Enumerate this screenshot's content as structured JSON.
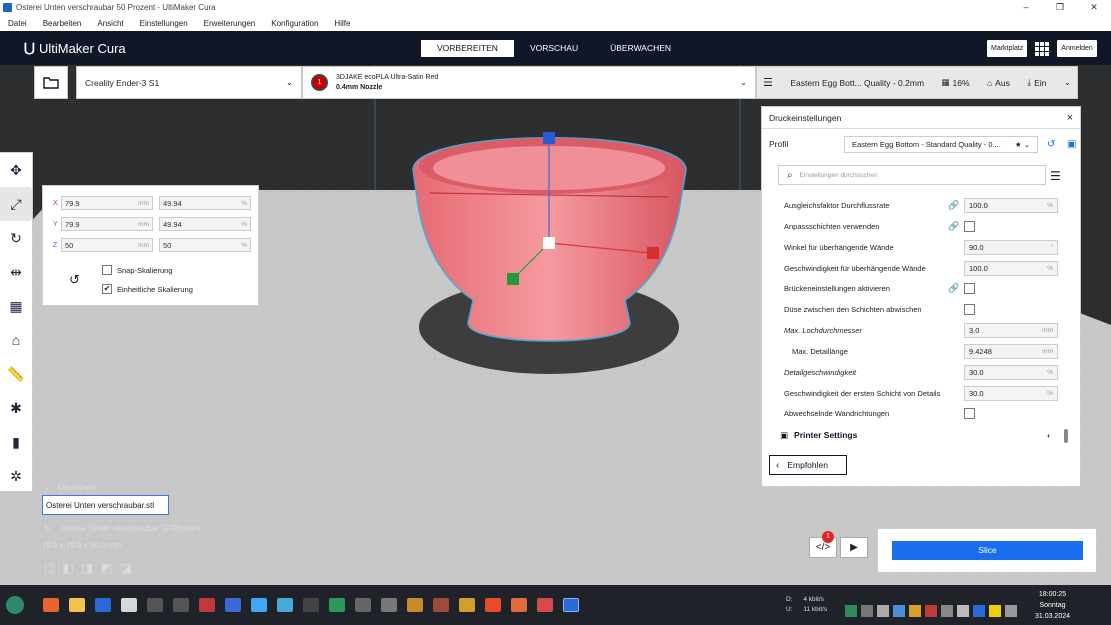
{
  "window": {
    "title": "Osterei Unten verschraubar 50 Prozent - UltiMaker Cura",
    "controls": [
      "–",
      "❐",
      "✕"
    ]
  },
  "menu": [
    "Datei",
    "Bearbeiten",
    "Ansicht",
    "Einstellungen",
    "Erweiterungen",
    "Konfiguration",
    "Hilfe"
  ],
  "header": {
    "logo": "UltiMaker Cura",
    "stages": [
      "VORBEREITEN",
      "VORSCHAU",
      "ÜBERWACHEN"
    ],
    "active_stage": "VORBEREITEN",
    "marketplace": "Marktplatz",
    "login": "Anmelden"
  },
  "toolbar": {
    "printer": "Creality Ender-3 S1",
    "material_index": "1",
    "material_name": "3DJAKE ecoPLA Ultra-Satin Red",
    "nozzle": "0.4mm Nozzle",
    "profile_summary": "Eastern Egg Bott... Quality - 0.2mm",
    "infill": "16%",
    "support": "Aus",
    "adhesion": "Ein"
  },
  "scale": {
    "x_mm": "79.9",
    "x_pct": "49.94",
    "y_mm": "79.9",
    "y_pct": "49.94",
    "z_mm": "50",
    "z_pct": "50",
    "unit_mm": "mm",
    "unit_pct": "%",
    "snap": "Snap-Skalierung",
    "uniform": "Einheitliche Skalierung",
    "labels": {
      "x": "X",
      "y": "Y",
      "z": "Z"
    }
  },
  "objects": {
    "header": "Objektliste",
    "file": "Osterei Unten verschraubar.stl",
    "name": "Osterei Unten verschraubar 50 Prozent",
    "dims": "79.9 x 79.9 x 50.0 mm"
  },
  "settings": {
    "title": "Druckeinstellungen",
    "profile_label": "Profil",
    "profile_value": "Eastern Egg Bottom - Standard Quality - 0....",
    "search_placeholder": "Einstellungen durchsuchen",
    "rows": [
      {
        "label": "Ausgleichsfaktor Durchflussrate",
        "value": "100.0",
        "unit": "%",
        "link": true
      },
      {
        "label": "Anpassschichten verwenden",
        "checkbox": true,
        "link": true
      },
      {
        "label": "Winkel für überhängende Wände",
        "value": "90.0",
        "unit": "°"
      },
      {
        "label": "Geschwindigkeit für überhängende Wände",
        "value": "100.0",
        "unit": "%"
      },
      {
        "label": "Brückeneinstellungen aktivieren",
        "checkbox": true,
        "link": true
      },
      {
        "label": "Düse zwischen den Schichten abwischen",
        "checkbox": true
      },
      {
        "label": "Max. Lochdurchmesser",
        "value": "3.0",
        "unit": "mm"
      },
      {
        "label": "Max. Detaillänge",
        "value": "9.4248",
        "unit": "mm"
      },
      {
        "label": "Detailgeschwindigkeit",
        "value": "30.0",
        "unit": "%"
      },
      {
        "label": "Geschwindigkeit der ersten Schicht von Details",
        "value": "30.0",
        "unit": "%"
      },
      {
        "label": "Abwechselnde Wandrichtungen",
        "checkbox": true
      }
    ],
    "printer_settings": "Printer Settings",
    "recommended": "Empfohlen"
  },
  "slice": {
    "label": "Slice",
    "badge": "1"
  },
  "tray": {
    "down": "4 kbit/s",
    "up": "11 kbit/s",
    "d": "D:",
    "u": "U:",
    "time": "18:00:25",
    "day": "Sonntag",
    "date": "31.03.2024"
  }
}
